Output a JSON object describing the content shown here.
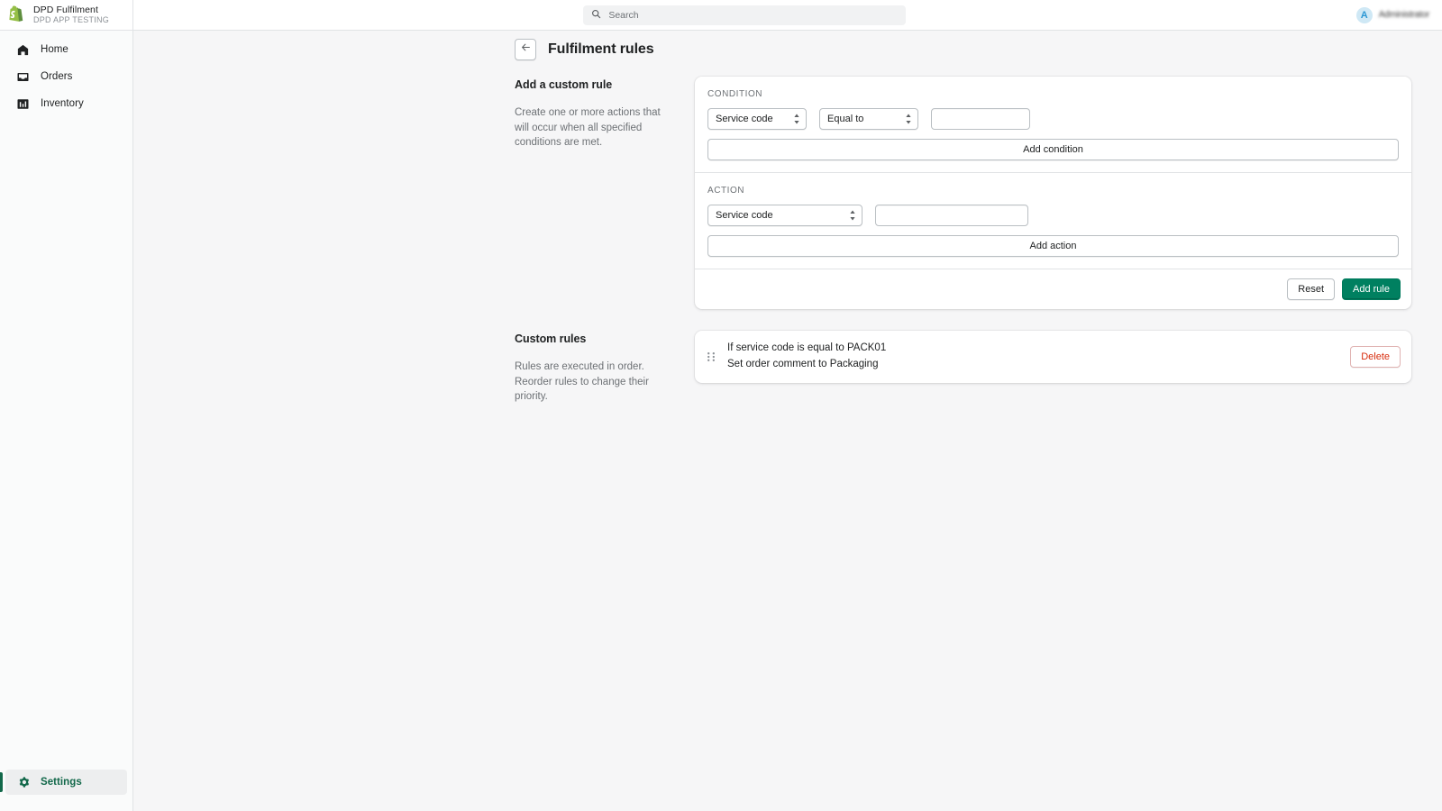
{
  "topbar": {
    "brand_title": "DPD Fulfilment",
    "brand_subtitle": "DPD APP TESTING",
    "search_placeholder": "Search",
    "avatar_initial": "A",
    "user_name": "Administrator"
  },
  "sidebar": {
    "items": [
      {
        "label": "Home",
        "icon": "home-icon",
        "active": false
      },
      {
        "label": "Orders",
        "icon": "orders-icon",
        "active": false
      },
      {
        "label": "Inventory",
        "icon": "inventory-icon",
        "active": false
      }
    ],
    "bottom_item": {
      "label": "Settings",
      "icon": "gear-icon",
      "active": true
    }
  },
  "page": {
    "title": "Fulfilment rules",
    "back_icon": "arrow-left-icon"
  },
  "add_rule_section": {
    "heading": "Add a custom rule",
    "description": "Create one or more actions that will occur when all specified conditions are met.",
    "condition_label": "CONDITION",
    "condition_field_value": "Service code",
    "condition_operator_value": "Equal to",
    "condition_value": "",
    "condition_value_placeholder": "",
    "add_condition_label": "Add condition",
    "action_label": "ACTION",
    "action_field_value": "Service code",
    "action_value": "",
    "action_value_placeholder": "",
    "add_action_label": "Add action",
    "reset_label": "Reset",
    "add_rule_label": "Add rule"
  },
  "custom_rules_section": {
    "heading": "Custom rules",
    "description": "Rules are executed in order. Reorder rules to change their priority.",
    "rules": [
      {
        "condition_text": "If service code is equal to PACK01",
        "action_text": "Set order comment to Packaging",
        "delete_label": "Delete",
        "drag_icon": "drag-handle-icon"
      }
    ]
  },
  "colors": {
    "brand_green": "#008060",
    "active_green": "#12684a",
    "danger_red": "#d72c0d",
    "page_bg": "#f6f6f7",
    "card_bg": "#ffffff",
    "border": "#e1e3e5",
    "avatar_bg": "#cfe8f5",
    "avatar_fg": "#2b97d4"
  }
}
